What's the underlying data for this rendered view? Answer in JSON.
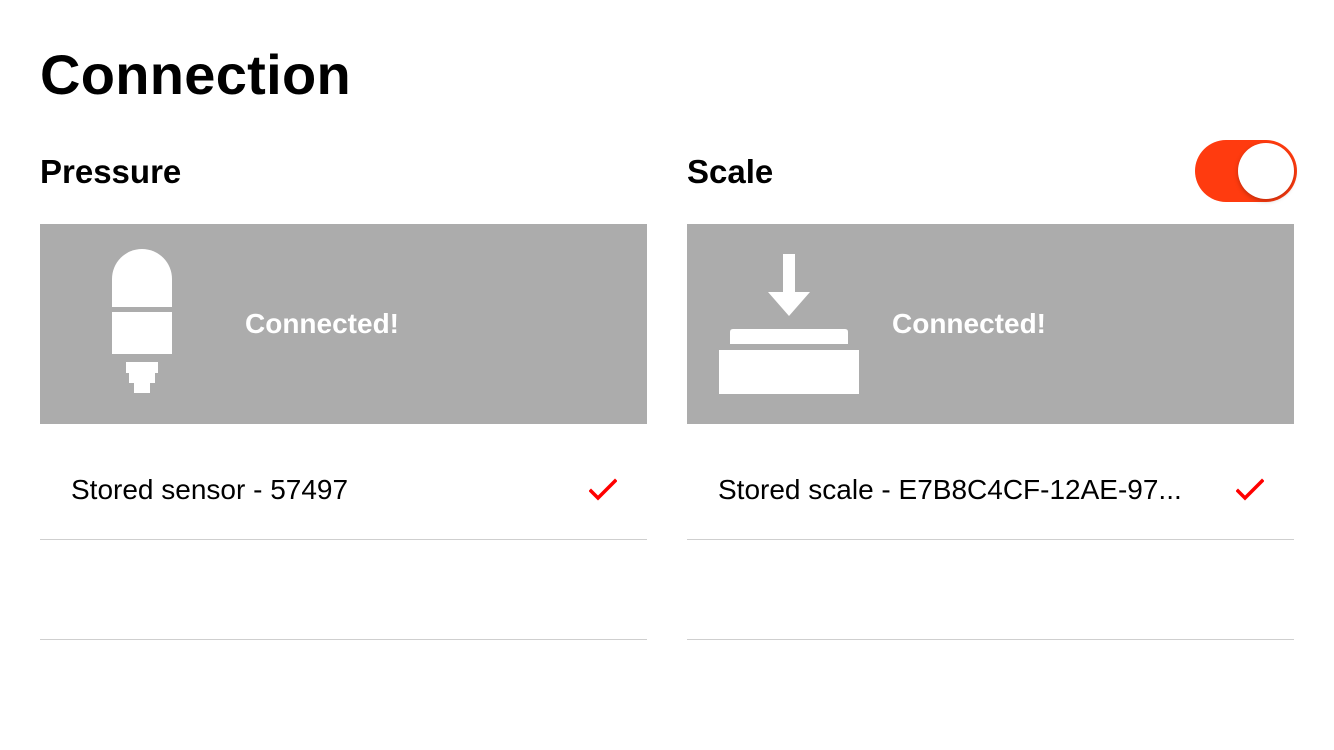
{
  "page_title": "Connection",
  "pressure": {
    "title": "Pressure",
    "status": "Connected!",
    "icon": "pressure-sensor-icon",
    "stored_item": "Stored sensor - 57497",
    "stored_selected": true
  },
  "scale": {
    "title": "Scale",
    "toggle_on": true,
    "status": "Connected!",
    "icon": "scale-icon",
    "stored_item": "Stored scale - E7B8C4CF-12AE-97...",
    "stored_selected": true
  },
  "colors": {
    "accent": "#ff3b0f",
    "check": "#ff0000",
    "card_bg": "#acacac",
    "divider": "#cfcfcf"
  }
}
